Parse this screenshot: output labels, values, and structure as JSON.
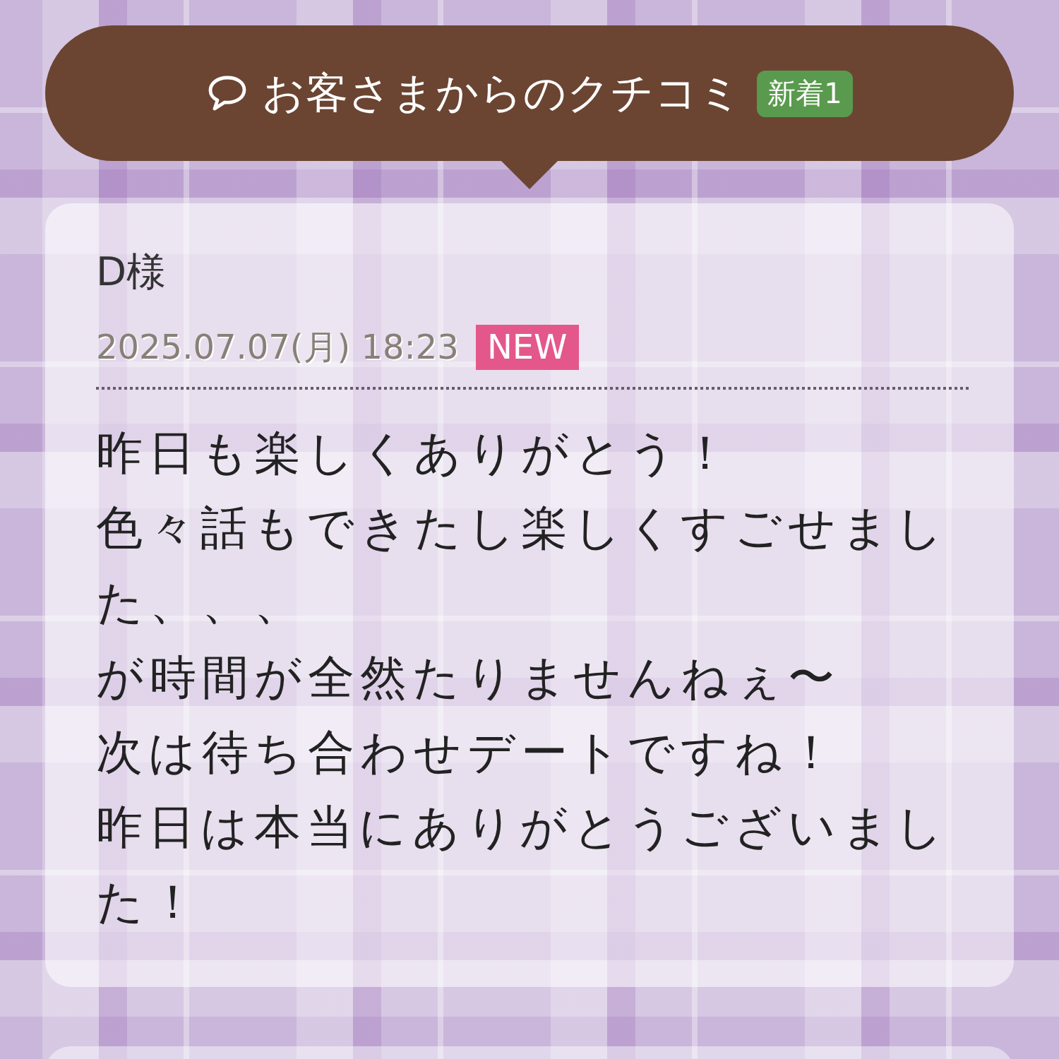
{
  "header": {
    "title": "お客さまからのクチコミ",
    "badge": "新着1"
  },
  "reviews": [
    {
      "name": "D様",
      "date": "2025.07.07(月) 18:23",
      "is_new": true,
      "new_label": "NEW",
      "message_lines": [
        "昨日も楽しくありがとう！",
        "色々話もできたし楽しくすごせました、、、",
        "が時間が全然たりませんねぇ〜",
        "次は待ち合わせデートですね！",
        "昨日は本当にありがとうございました！"
      ]
    }
  ]
}
